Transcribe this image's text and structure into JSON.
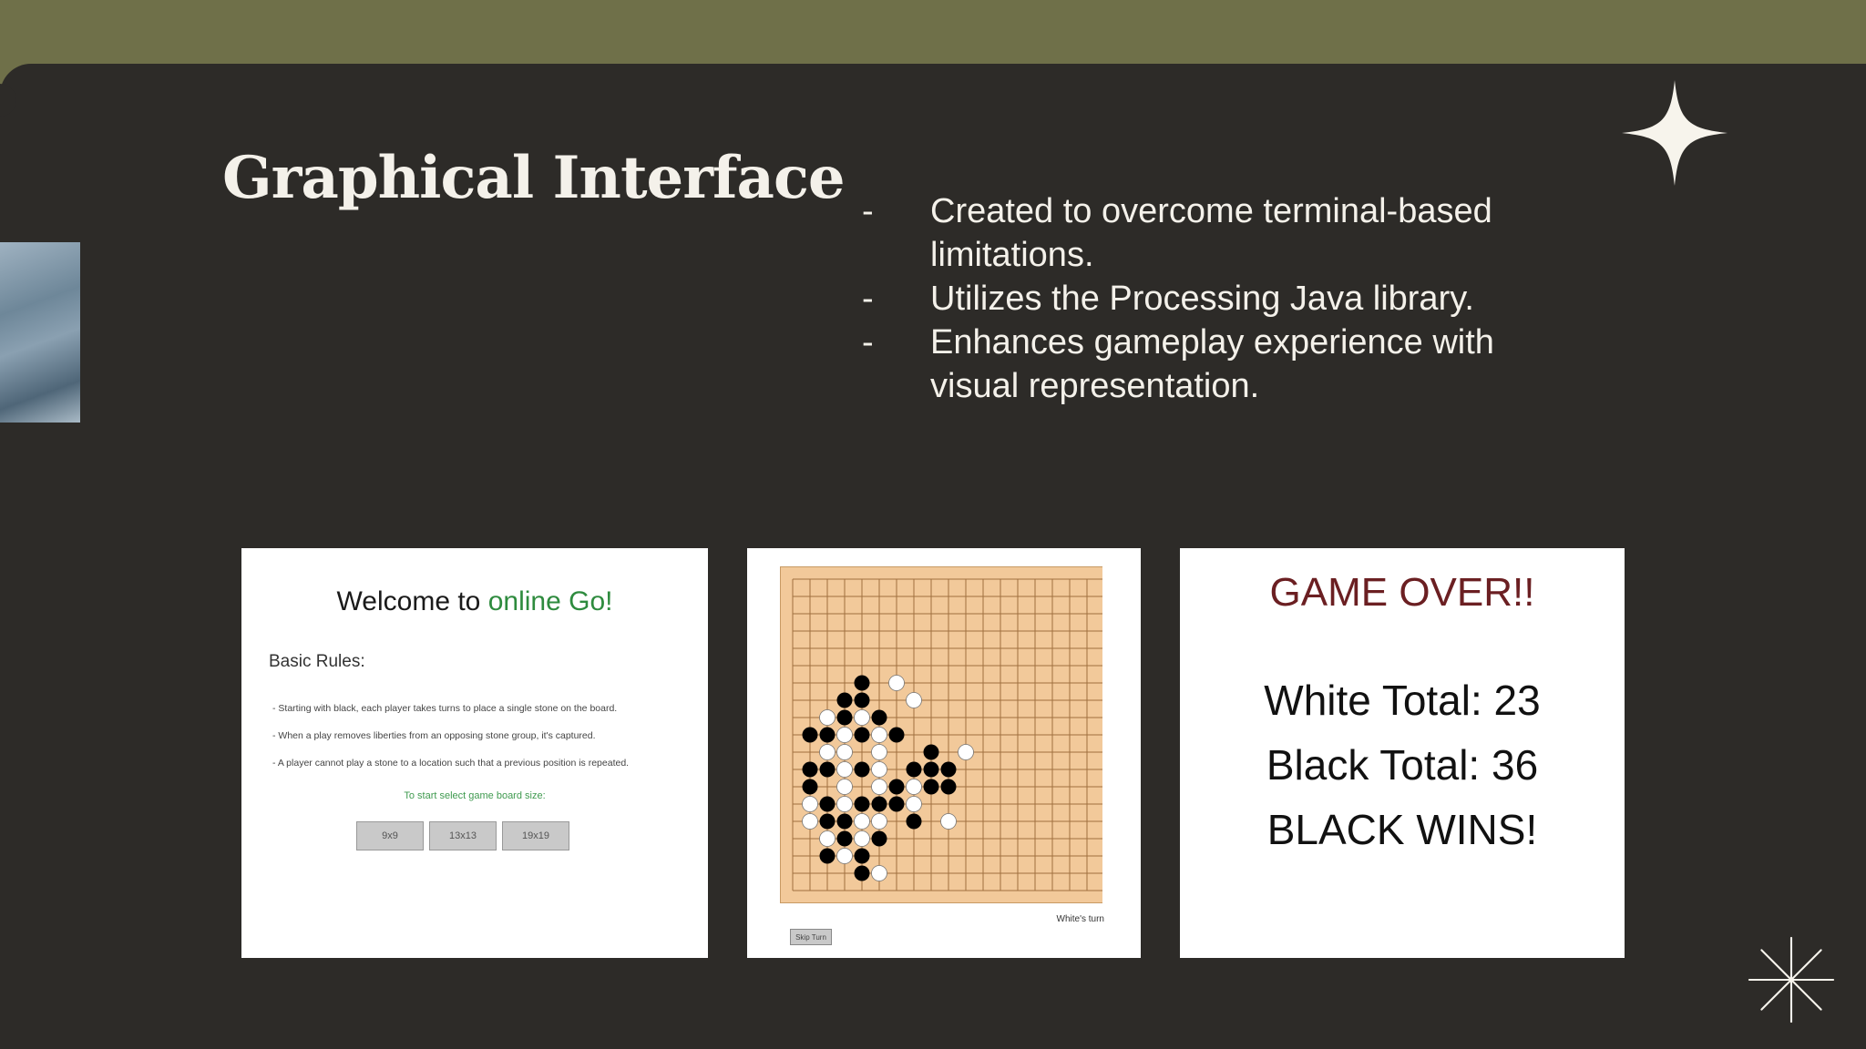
{
  "slide": {
    "title": "Graphical Interface",
    "bullets": [
      {
        "marker": "-",
        "text": "Created to overcome terminal-based limitations."
      },
      {
        "marker": "-",
        "text": "Utilizes the Processing Java library."
      },
      {
        "marker": "-",
        "text": "Enhances gameplay experience with visual representation."
      }
    ]
  },
  "welcome_screen": {
    "title_prefix": "Welcome to ",
    "title_highlight": "online Go!",
    "rules_heading": "Basic Rules:",
    "rules": [
      "- Starting with black, each player takes turns to place a single stone on the board.",
      "- When a play removes liberties from an opposing stone group, it's captured.",
      "- A player cannot play a stone to a location such that a previous position is repeated."
    ],
    "hint": "To start select game board size:",
    "size_buttons": [
      "9x9",
      "13x13",
      "19x19"
    ]
  },
  "board_screen": {
    "board_size": 19,
    "skip_label": "Skip Turn",
    "turn_label": "White's turn"
  },
  "gameover_screen": {
    "title": "GAME OVER!!",
    "white_total": "White Total: 23",
    "black_total": "Black Total: 36",
    "result": "BLACK WINS!"
  },
  "colors": {
    "top_band": "#6f7049",
    "slide_bg": "#2d2b28",
    "board_wood": "#f2c99a",
    "board_line": "#a0703f",
    "accent_green": "#2e8b3e",
    "gameover_red": "#6b1f22"
  }
}
